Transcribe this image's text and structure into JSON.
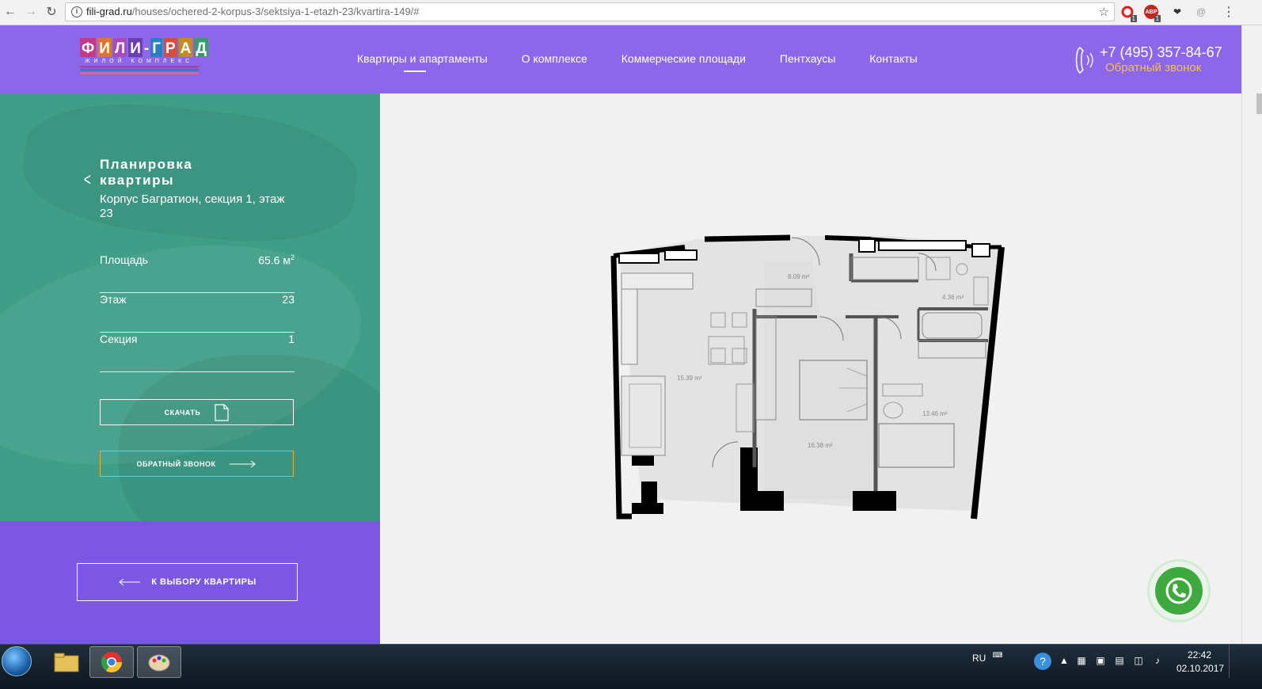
{
  "browser": {
    "url_domain": "fili-grad.ru",
    "url_path": "/houses/ochered-2-korpus-3/sektsiya-1-etazh-23/kvartira-149/#",
    "ext_badge_1": "1",
    "ext_badge_2": "1",
    "ext_abp": "ABP"
  },
  "header": {
    "logo_letters": [
      "Ф",
      "И",
      "Л",
      "И",
      "-",
      "Г",
      "Р",
      "А",
      "Д"
    ],
    "logo_subtitle": "ЖИЛОЙ КОМПЛЕКС",
    "menu": [
      {
        "label": "Квартиры и апартаменты"
      },
      {
        "label": "О комплексе"
      },
      {
        "label": "Коммерческие площади"
      },
      {
        "label": "Пентхаусы"
      },
      {
        "label": "Контакты"
      }
    ],
    "phone": "+7 (495) 357-84-67",
    "callback_link": "Обратный звонок"
  },
  "plan": {
    "title": "Планировка квартиры",
    "subtitle": "Корпус Багратион, секция 1, этаж 23",
    "stats": [
      {
        "label": "Площадь",
        "value": "65.6 м",
        "sup": "2"
      },
      {
        "label": "Этаж",
        "value": "23",
        "sup": ""
      },
      {
        "label": "Секция",
        "value": "1",
        "sup": ""
      }
    ],
    "download_label": "СКАЧАТЬ",
    "callback_label": "ОБРАТНЫЙ ЗВОНОК",
    "back_label": "К ВЫБОРУ КВАРТИРЫ"
  },
  "floorplan": {
    "rooms": [
      "15.39 m²",
      "8.09 m²",
      "4.36 m²",
      "16.38 m²",
      "13.46 m²"
    ]
  },
  "taskbar": {
    "lang": "RU",
    "time": "22:42",
    "date": "02.10.2017"
  },
  "colors": {
    "header_purple": "#8c67ea",
    "panel_green": "#3f9e87",
    "panel_purple": "#7c57e2",
    "accent_gold": "#f2c14e"
  }
}
